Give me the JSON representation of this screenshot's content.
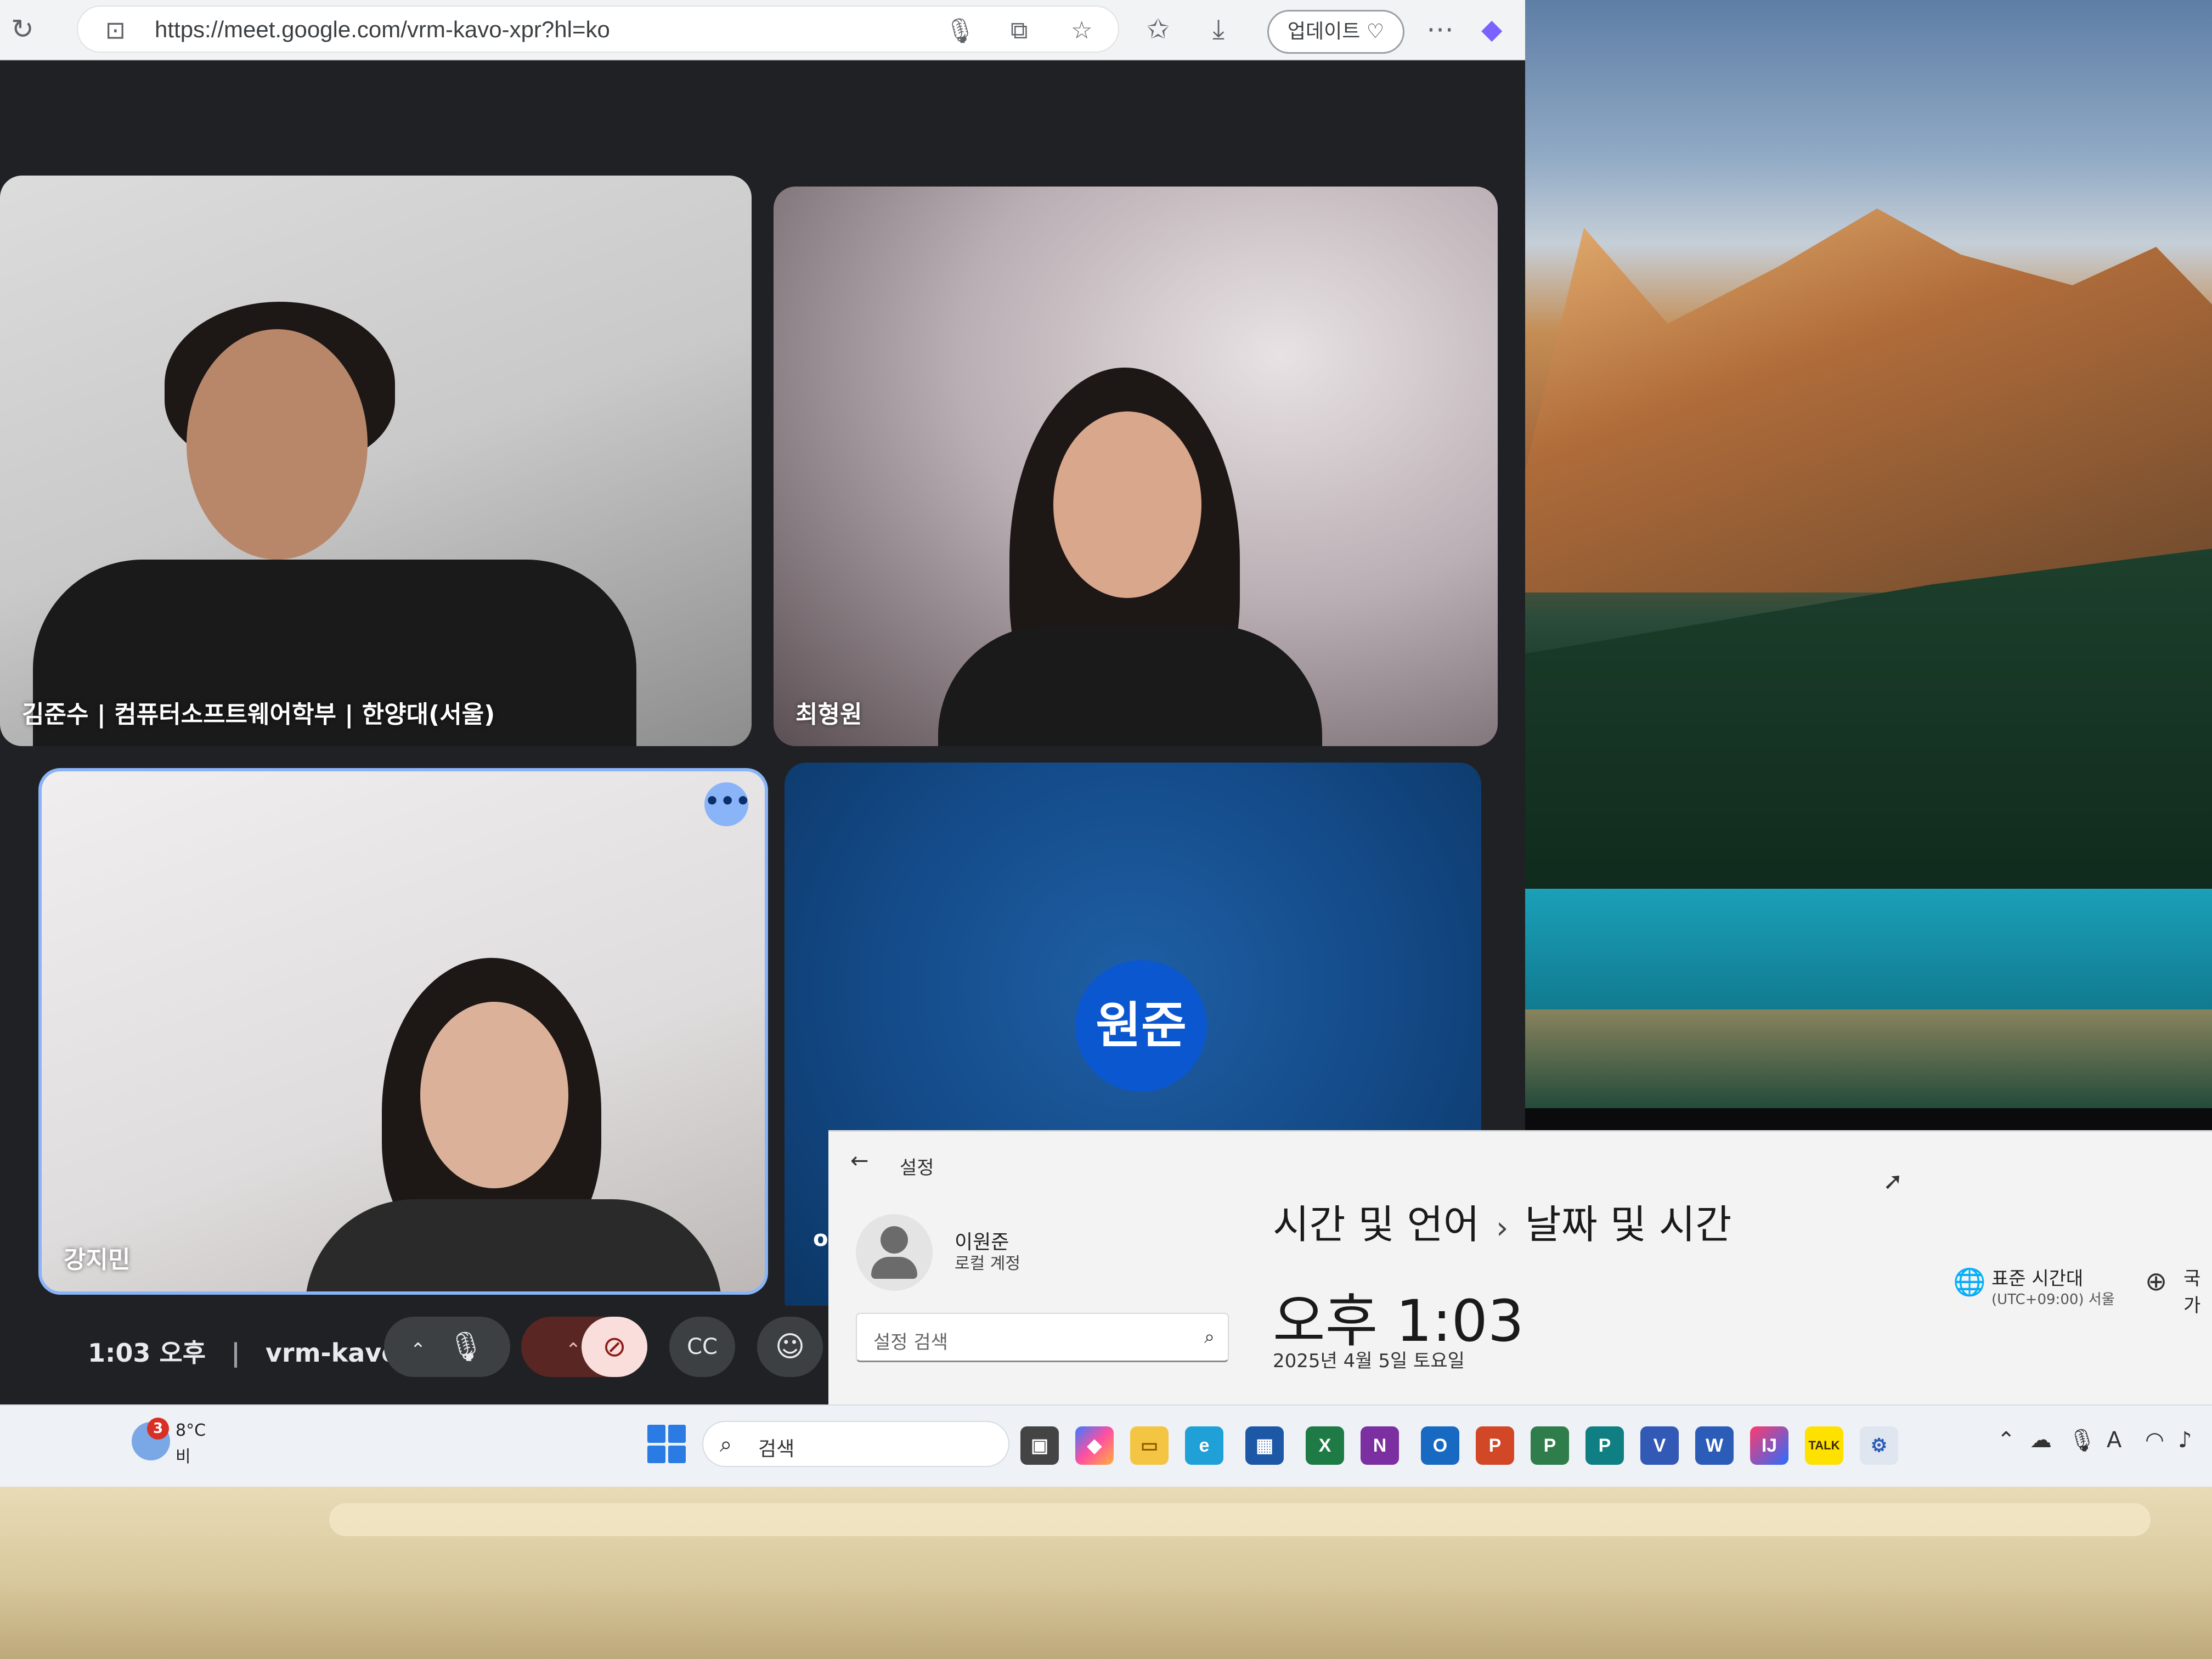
{
  "browser": {
    "url": "https://meet.google.com/vrm-kavo-xpr?hl=ko",
    "update_label": "업데이트"
  },
  "meet": {
    "tiles": [
      {
        "name": "김준수 | 컴퓨터소프트웨어학부 | 한양대(서울)"
      },
      {
        "name": "최형원"
      },
      {
        "name": "강지민"
      },
      {
        "name": "이원준",
        "avatar_text": "원준"
      }
    ],
    "meeting_time": "1:03 오후",
    "meeting_code": "vrm-kavo-xpr",
    "controls": {
      "more_options": "•••",
      "captions": "CC"
    }
  },
  "settings": {
    "window_title": "설정",
    "user_name": "이원준",
    "account_type": "로컬 계정",
    "search_placeholder": "설정 검색",
    "breadcrumb_parent": "시간 및 언어",
    "breadcrumb_current": "날짜 및 시간",
    "current_time": "오후 1:03",
    "current_date": "2025년 4월 5일 토요일",
    "timezone_label": "표준 시간대",
    "timezone_value": "(UTC+09:00) 서울",
    "region_label": "국가"
  },
  "taskbar": {
    "weather_badge": "3",
    "weather_temp": "8°C",
    "weather_desc": "비",
    "search_label": "검색",
    "apps": [
      "Copilot",
      "File Explorer",
      "Edge",
      "Store",
      "Excel",
      "OneNote",
      "Outlook",
      "PowerPoint",
      "Project",
      "Publisher",
      "Visio",
      "Word",
      "IntelliJ",
      "KakaoTalk",
      "Settings"
    ],
    "kakao_label": "TALK"
  },
  "colors": {
    "meet_bg": "#202124",
    "accent_blue": "#0b57d0",
    "highlight_border": "#8ab4f8",
    "mute_red": "#f9dedc"
  }
}
